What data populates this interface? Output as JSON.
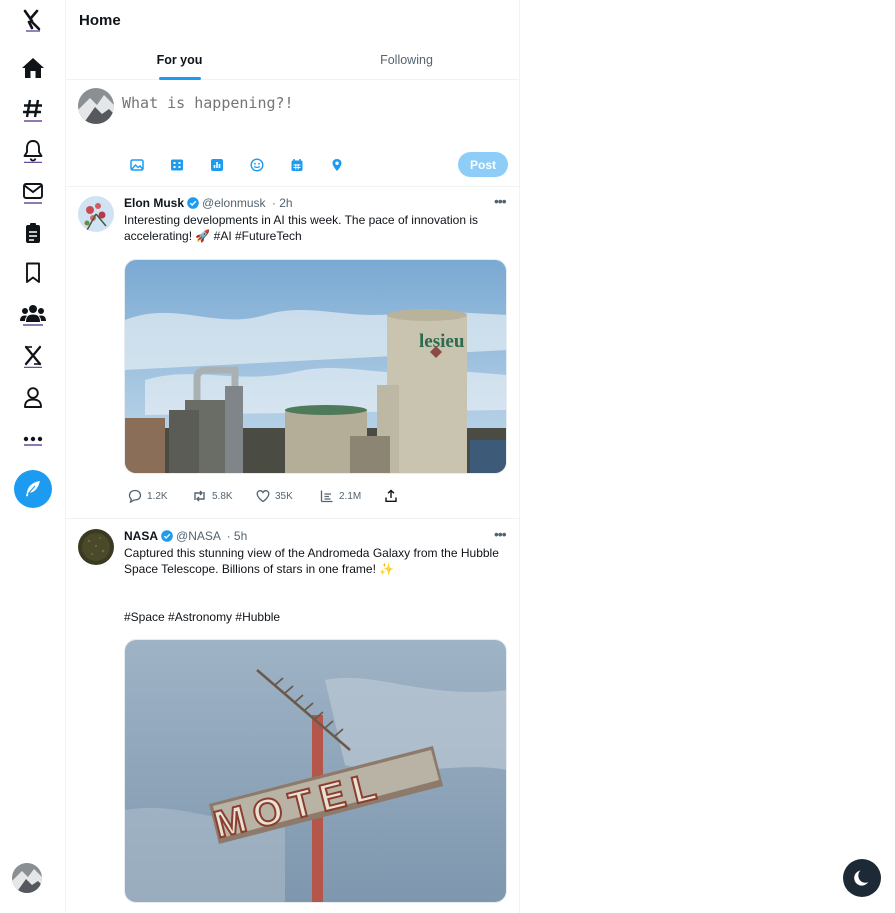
{
  "sidebar": {
    "items": [
      {
        "name": "x-logo-icon"
      },
      {
        "name": "home-icon"
      },
      {
        "name": "explore-icon"
      },
      {
        "name": "notifications-icon"
      },
      {
        "name": "messages-icon"
      },
      {
        "name": "lists-icon"
      },
      {
        "name": "bookmarks-icon"
      },
      {
        "name": "communities-icon"
      },
      {
        "name": "premium-icon"
      },
      {
        "name": "profile-icon"
      },
      {
        "name": "more-icon"
      }
    ],
    "compose_icon": "feather-icon"
  },
  "header": {
    "title": "Home"
  },
  "tabs": [
    {
      "label": "For you",
      "active": true
    },
    {
      "label": "Following",
      "active": false
    }
  ],
  "composer": {
    "placeholder": "What is happening?!",
    "tools": [
      "image-icon",
      "gif-icon",
      "poll-icon",
      "emoji-icon",
      "schedule-icon",
      "location-icon"
    ],
    "post_label": "Post"
  },
  "tweets": [
    {
      "name": "Elon Musk",
      "handle": "@elonmusk",
      "time": "· 2h",
      "text": "Interesting developments in AI this week. The pace of innovation is accelerating! 🚀 #AI #FutureTech",
      "media": "industrial-silos-photo",
      "media_text": "lesieu",
      "stats": {
        "replies": "1.2K",
        "retweets": "5.8K",
        "likes": "35K",
        "views": "2.1M"
      }
    },
    {
      "name": "NASA",
      "handle": "@NASA",
      "time": "· 5h",
      "text": "Captured this stunning view of the Andromeda Galaxy from the Hubble Space Telescope. Billions of stars in one frame! ✨",
      "hashtags": "#Space #Astronomy #Hubble",
      "media": "motel-sign-photo",
      "media_text": "MOTEL"
    }
  ],
  "colors": {
    "accent": "#1d9bf0",
    "post_disabled": "#8ecdf8",
    "text_primary": "#0f1419",
    "text_secondary": "#536471",
    "theme_toggle_bg": "#1d2a35"
  }
}
